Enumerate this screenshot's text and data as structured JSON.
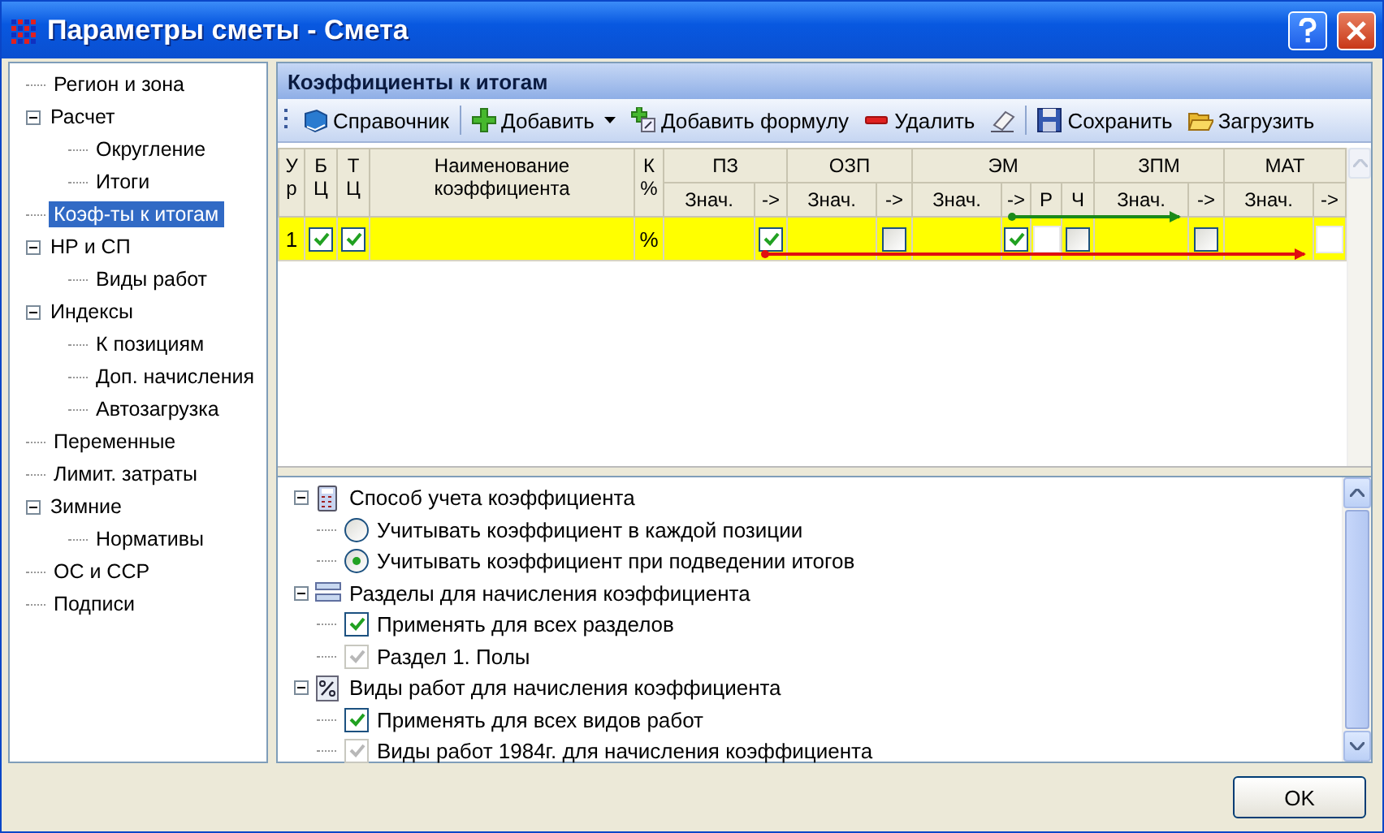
{
  "window": {
    "title": "Параметры сметы - Смета"
  },
  "sidebar": {
    "items": [
      {
        "label": "Регион и зона",
        "selected": false
      },
      {
        "label": "Расчет",
        "selected": false,
        "expanded": true,
        "children": [
          {
            "label": "Округление",
            "selected": false
          },
          {
            "label": "Итоги",
            "selected": false
          }
        ]
      },
      {
        "label": "Коэф-ты к итогам",
        "selected": true
      },
      {
        "label": "НР и СП",
        "selected": false,
        "expanded": true,
        "children": [
          {
            "label": "Виды работ",
            "selected": false
          }
        ]
      },
      {
        "label": "Индексы",
        "selected": false,
        "expanded": true,
        "children": [
          {
            "label": "К позициям",
            "selected": false
          },
          {
            "label": "Доп. начисления",
            "selected": false
          },
          {
            "label": "Автозагрузка",
            "selected": false
          }
        ]
      },
      {
        "label": "Переменные",
        "selected": false
      },
      {
        "label": "Лимит. затраты",
        "selected": false
      },
      {
        "label": "Зимние",
        "selected": false,
        "expanded": true,
        "children": [
          {
            "label": "Нормативы",
            "selected": false
          }
        ]
      },
      {
        "label": "ОС и ССР",
        "selected": false
      },
      {
        "label": "Подписи",
        "selected": false
      }
    ]
  },
  "panel": {
    "title": "Коэффициенты к итогам"
  },
  "toolbar": [
    {
      "label": "Справочник"
    },
    {
      "label": "Добавить",
      "dropdown": true
    },
    {
      "label": "Добавить формулу"
    },
    {
      "label": "Удалить"
    },
    {
      "kind": "icon"
    },
    {
      "label": "Сохранить"
    },
    {
      "label": "Загрузить"
    }
  ],
  "grid": {
    "columns": [
      {
        "label": "У р"
      },
      {
        "label": "Б Ц"
      },
      {
        "label": "Т Ц"
      },
      {
        "label": "Наименование коэффициента"
      },
      {
        "label": "К %"
      },
      {
        "label": "ПЗ",
        "sub": [
          "Знач.",
          "->"
        ]
      },
      {
        "label": "ОЗП",
        "sub": [
          "Знач.",
          "->"
        ]
      },
      {
        "label": "ЭМ",
        "sub": [
          "Знач.",
          "->",
          "Р",
          "Ч"
        ]
      },
      {
        "label": "ЗПМ",
        "sub": [
          "Знач.",
          "->"
        ]
      },
      {
        "label": "МАТ",
        "sub": [
          "Знач.",
          "->"
        ]
      }
    ],
    "rows": [
      {
        "selected": true,
        "cells": [
          {
            "kind": "text",
            "text": "1"
          },
          {
            "kind": "check",
            "checked": true
          },
          {
            "kind": "check",
            "checked": true
          },
          {
            "kind": "empty"
          },
          {
            "kind": "text",
            "text": "%"
          },
          {
            "kind": "empty"
          },
          {
            "kind": "check",
            "checked": true
          },
          {
            "kind": "empty"
          },
          {
            "kind": "check",
            "checked": false
          },
          {
            "kind": "empty"
          },
          {
            "kind": "check",
            "checked": true
          },
          {
            "kind": "box"
          },
          {
            "kind": "check",
            "checked": false
          },
          {
            "kind": "empty"
          },
          {
            "kind": "check",
            "checked": false
          },
          {
            "kind": "empty"
          },
          {
            "kind": "box"
          }
        ]
      }
    ]
  },
  "options": [
    {
      "label": "Способ учета коэффициента",
      "expanded": true,
      "children": [
        {
          "kind": "radio",
          "label": "Учитывать коэффициент в каждой позиции",
          "checked": false,
          "disabled": false
        },
        {
          "kind": "radio",
          "label": "Учитывать коэффициент при подведении итогов",
          "checked": true,
          "disabled": false
        }
      ]
    },
    {
      "label": "Разделы для начисления коэффициента",
      "expanded": true,
      "children": [
        {
          "kind": "check",
          "label": "Применять для всех разделов",
          "checked": true,
          "disabled": false
        },
        {
          "kind": "check",
          "label": "Раздел 1. Полы",
          "checked": true,
          "disabled": true
        }
      ]
    },
    {
      "label": "Виды работ для начисления коэффициента",
      "expanded": true,
      "children": [
        {
          "kind": "check",
          "label": "Применять для всех видов работ",
          "checked": true,
          "disabled": false
        },
        {
          "kind": "check",
          "label": "Виды работ 1984г. для начисления коэффициента",
          "checked": true,
          "disabled": true
        }
      ]
    }
  ],
  "footer": {
    "ok": "OK"
  }
}
